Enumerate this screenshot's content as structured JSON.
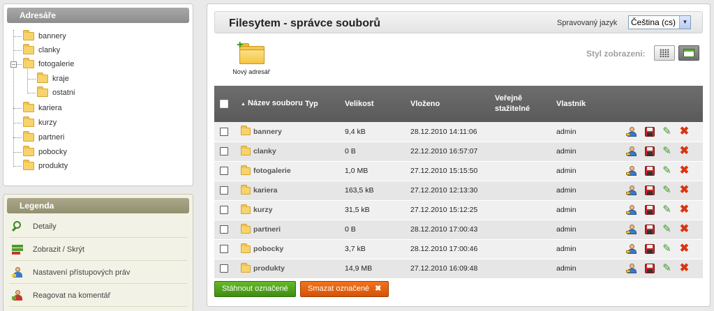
{
  "sidebar": {
    "directories_title": "Adresáře",
    "tree": [
      {
        "label": "bannery"
      },
      {
        "label": "clanky"
      },
      {
        "label": "fotogalerie",
        "toggle": "–"
      },
      {
        "label": "kraje"
      },
      {
        "label": "ostatni"
      },
      {
        "label": "kariera"
      },
      {
        "label": "kurzy"
      },
      {
        "label": "partneri"
      },
      {
        "label": "pobocky"
      },
      {
        "label": "produkty"
      }
    ],
    "legend_title": "Legenda",
    "legend": [
      {
        "label": "Detaily",
        "icon": "magnifier-icon"
      },
      {
        "label": "Zobrazit / Skrýt",
        "icon": "show-hide-icon"
      },
      {
        "label": "Nastavení přístupových práv",
        "icon": "user-key-icon"
      },
      {
        "label": "Reagovat na komentář",
        "icon": "user-comment-icon"
      }
    ]
  },
  "header": {
    "title": "Filesytem - správce souborů",
    "language_label": "Spravovaný jazyk",
    "language_value": "Čeština (cs)"
  },
  "toolbar": {
    "new_dir_label": "Nový adresář",
    "view_style_label": "Styl zobrazeni:"
  },
  "table": {
    "headers": {
      "name": "Název souboru",
      "type": "Typ",
      "size": "Velikost",
      "inserted": "Vloženo",
      "public": "Veřejně stažitelné",
      "owner": "Vlastník"
    },
    "rows": [
      {
        "name": "bannery",
        "type": "",
        "size": "9,4 kB",
        "inserted": "28.12.2010 14:11:06",
        "public": "",
        "owner": "admin"
      },
      {
        "name": "clanky",
        "type": "",
        "size": "0 B",
        "inserted": "22.12.2010 16:57:07",
        "public": "",
        "owner": "admin"
      },
      {
        "name": "fotogalerie",
        "type": "",
        "size": "1,0 MB",
        "inserted": "27.12.2010 15:15:50",
        "public": "",
        "owner": "admin"
      },
      {
        "name": "kariera",
        "type": "",
        "size": "163,5 kB",
        "inserted": "27.12.2010 12:13:30",
        "public": "",
        "owner": "admin"
      },
      {
        "name": "kurzy",
        "type": "",
        "size": "31,5 kB",
        "inserted": "27.12.2010 15:12:25",
        "public": "",
        "owner": "admin"
      },
      {
        "name": "partneri",
        "type": "",
        "size": "0 B",
        "inserted": "28.12.2010 17:00:43",
        "public": "",
        "owner": "admin"
      },
      {
        "name": "pobocky",
        "type": "",
        "size": "3,7 kB",
        "inserted": "28.12.2010 17:00:46",
        "public": "",
        "owner": "admin"
      },
      {
        "name": "produkty",
        "type": "",
        "size": "14,9 MB",
        "inserted": "27.12.2010 16:09:48",
        "public": "",
        "owner": "admin"
      }
    ]
  },
  "footer": {
    "download_label": "Stáhnout označené",
    "delete_label": "Smazat označené",
    "delete_glyph": "✖"
  }
}
